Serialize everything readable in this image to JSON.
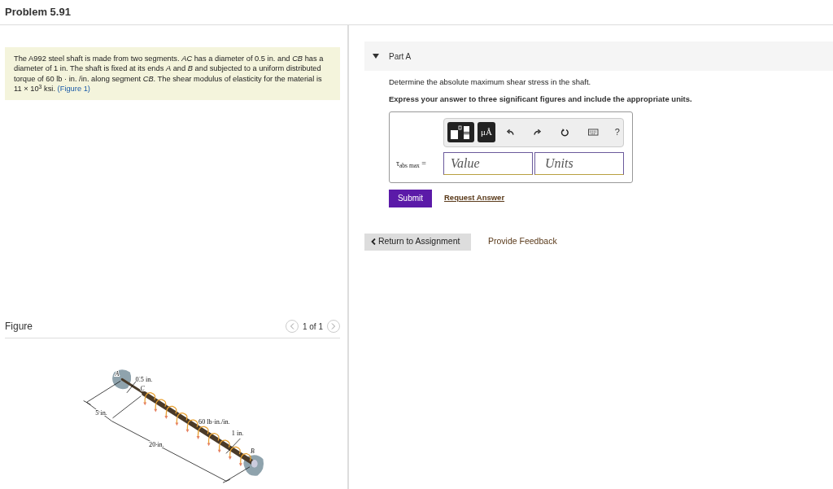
{
  "title": "Problem 5.91",
  "problem": {
    "text": "The A992 steel shaft is made from two segments. *AC* has a diameter of 0.5 in. and *CB* has a diameter of 1 in. The shaft is fixed at its ends *A* and *B* and subjected to a uniform distributed torque of 60 lb · in. /in. along segment *CB*. The shear modulus of elasticity for the material is 11 × 10$^{3}$ ksi.",
    "link": "(Figure 1)"
  },
  "figure": {
    "heading": "Figure",
    "pager": "1 of 1",
    "labels": [
      "A",
      "0.5 in.",
      "C",
      "5 in.",
      "60 lb·in./in.",
      "1 in.",
      "20 in.",
      "B"
    ]
  },
  "part": {
    "title": "Part A",
    "expanded": true,
    "question": "Determine the absolute maximum shear stress in the shaft.",
    "instruction": "Express your answer to three significant figures and include the appropriate units.",
    "toolbar": {
      "units_button": "μÅ",
      "help": "?"
    },
    "answer_label": "τ$_{abs max}$ =",
    "value_placeholder": "Value",
    "units_placeholder": "Units",
    "submit": "Submit",
    "request": "Request Answer"
  },
  "footer": {
    "return": "Return to Assignment",
    "feedback": "Provide Feedback"
  }
}
